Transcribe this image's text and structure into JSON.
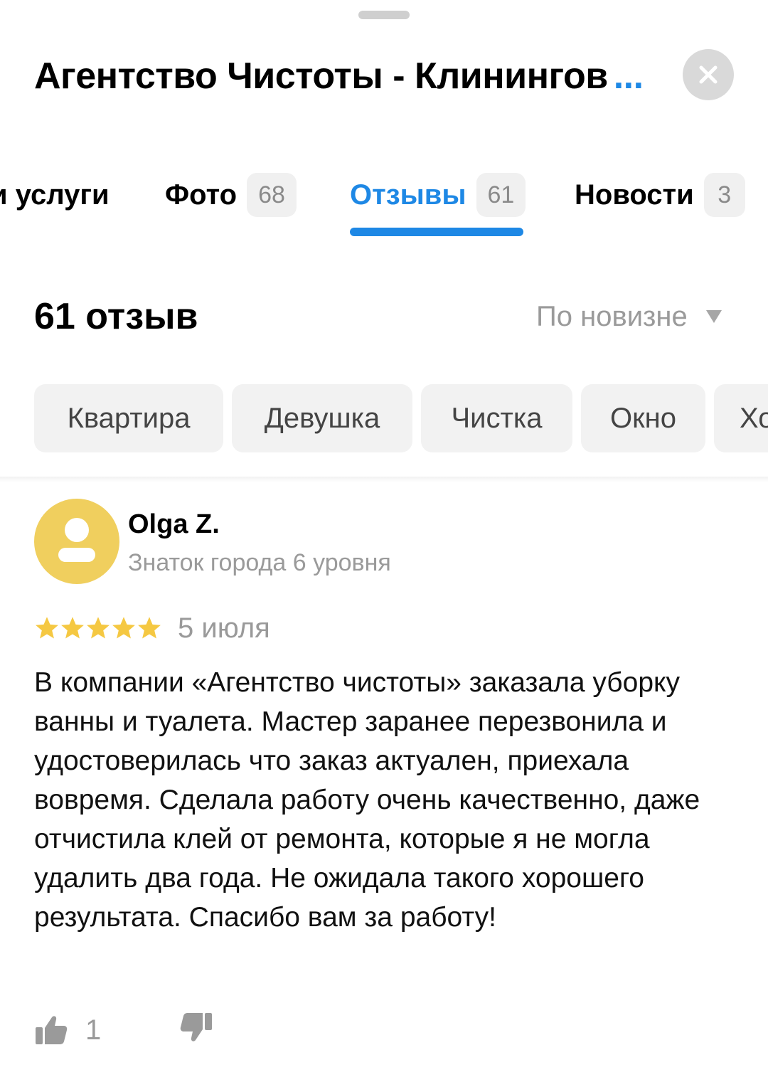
{
  "header": {
    "title": "Агентство Чистоты - Клинингов",
    "ellipsis": "...",
    "close_icon": "close-icon"
  },
  "tabs": [
    {
      "label": "и услуги",
      "badge": "",
      "active": false
    },
    {
      "label": "Фото",
      "badge": "68",
      "active": false
    },
    {
      "label": "Отзывы",
      "badge": "61",
      "active": true
    },
    {
      "label": "Новости",
      "badge": "3",
      "active": false
    }
  ],
  "reviews_header": {
    "count_label": "61 отзыв",
    "sort_label": "По новизне",
    "sort_icon": "triangle-down-icon"
  },
  "chips": [
    "Квартира",
    "Девушка",
    "Чистка",
    "Окно",
    "Хо"
  ],
  "review": {
    "author": "Olga Z.",
    "level": "Знаток города 6 уровня",
    "rating": 5,
    "rating_max": 5,
    "date": "5 июля",
    "text": "В компании «Агентство чистоты» заказала уборку ванны и туалета. Мастер заранее перезвонила и удостоверилась что заказ актуален, приехала вовремя. Сделала работу очень качественно, даже отчистила клей от ремонта, которые я не могла удалить два года. Не ожидала такого хорошего результата. Спасибо вам за работу!",
    "likes": "1"
  },
  "colors": {
    "accent": "#1e88e5",
    "star": "#f5c842",
    "avatar_bg": "#f0cf5e",
    "muted_text": "#9a9a9a"
  }
}
